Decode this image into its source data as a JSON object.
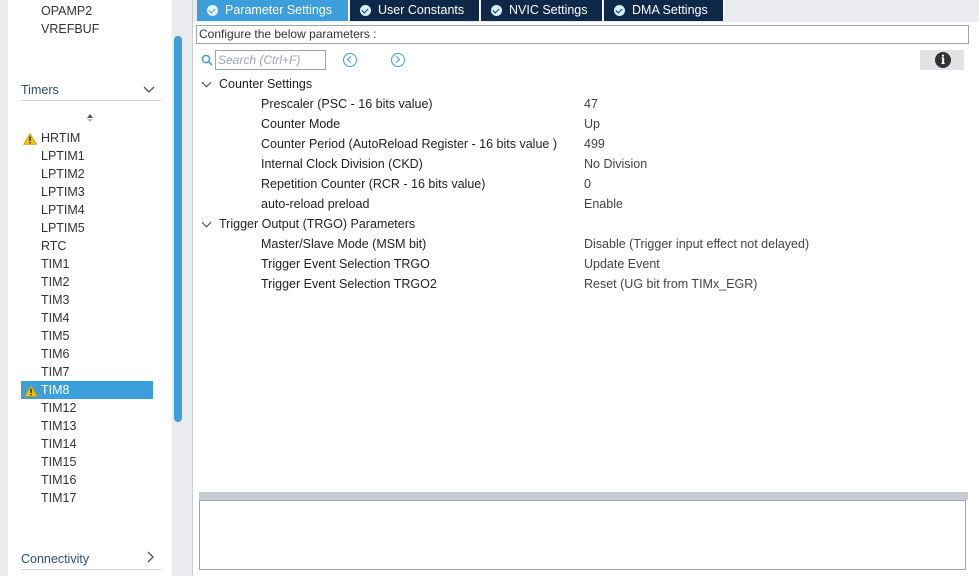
{
  "left_panel": {
    "top_items": [
      "OPAMP2",
      "VREFBUF"
    ],
    "timers_category": {
      "label": "Timers"
    },
    "timer_items": [
      {
        "label": "HRTIM",
        "warning": true
      },
      {
        "label": "LPTIM1"
      },
      {
        "label": "LPTIM2"
      },
      {
        "label": "LPTIM3"
      },
      {
        "label": "LPTIM4"
      },
      {
        "label": "LPTIM5"
      },
      {
        "label": "RTC"
      },
      {
        "label": "TIM1"
      },
      {
        "label": "TIM2"
      },
      {
        "label": "TIM3"
      },
      {
        "label": "TIM4"
      },
      {
        "label": "TIM5"
      },
      {
        "label": "TIM6"
      },
      {
        "label": "TIM7"
      },
      {
        "label": "TIM8",
        "warning": true,
        "selected": true
      },
      {
        "label": "TIM12"
      },
      {
        "label": "TIM13"
      },
      {
        "label": "TIM14"
      },
      {
        "label": "TIM15"
      },
      {
        "label": "TIM16"
      },
      {
        "label": "TIM17"
      }
    ],
    "connectivity_category": {
      "label": "Connectivity"
    },
    "icons": {
      "warning": "warning-icon",
      "collapse": "chevron-down-icon",
      "expand": "chevron-right-icon",
      "sort": "sort-arrow-icon"
    }
  },
  "tabs": [
    {
      "label": "Parameter Settings",
      "active": true
    },
    {
      "label": "User Constants"
    },
    {
      "label": "NVIC Settings"
    },
    {
      "label": "DMA Settings"
    }
  ],
  "configure_label": "Configure the below parameters :",
  "search": {
    "placeholder": "Search (Ctrl+F)"
  },
  "groups": [
    {
      "label": "Counter Settings",
      "params": [
        {
          "name": "Prescaler (PSC - 16 bits value)",
          "value": "47"
        },
        {
          "name": "Counter Mode",
          "value": "Up"
        },
        {
          "name": "Counter Period (AutoReload Register - 16 bits value )",
          "value": "499"
        },
        {
          "name": "Internal Clock Division (CKD)",
          "value": "No Division"
        },
        {
          "name": "Repetition Counter (RCR - 16 bits value)",
          "value": "0"
        },
        {
          "name": "auto-reload preload",
          "value": "Enable"
        }
      ]
    },
    {
      "label": "Trigger Output (TRGO) Parameters",
      "params": [
        {
          "name": "Master/Slave Mode (MSM bit)",
          "value": "Disable (Trigger input effect not delayed)"
        },
        {
          "name": "Trigger Event Selection TRGO",
          "value": "Update Event"
        },
        {
          "name": "Trigger Event Selection TRGO2",
          "value": "Reset (UG bit from TIMx_EGR)"
        }
      ]
    }
  ],
  "colors": {
    "accent": "#3c9edb",
    "tab_dark": "#0d2849",
    "warning": "#f2c200"
  },
  "info_icon": "info-icon"
}
